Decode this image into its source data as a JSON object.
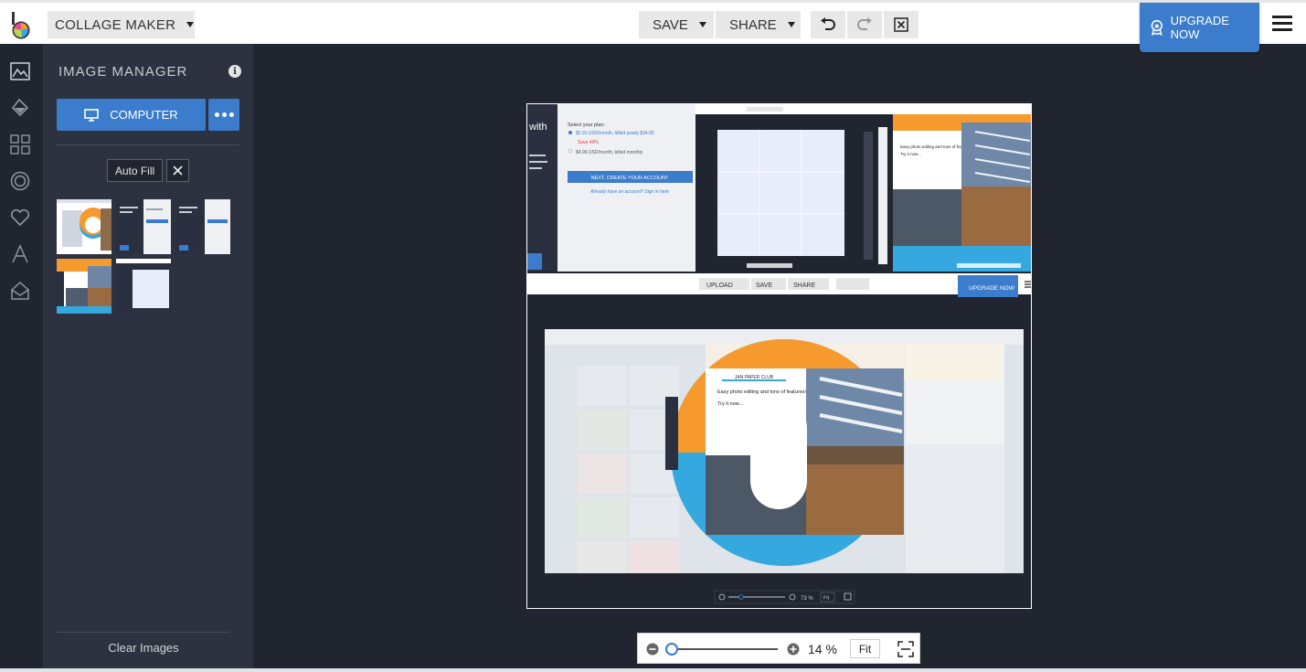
{
  "topbar": {
    "app_menu_label": "COLLAGE MAKER",
    "save_label": "SAVE",
    "share_label": "SHARE",
    "upgrade_label": "UPGRADE NOW",
    "icons": [
      "logo",
      "undo-icon",
      "redo-icon",
      "close-doc-icon",
      "upgrade-icon",
      "hamburger-icon"
    ]
  },
  "rail": {
    "icons": [
      "image-manager-icon",
      "background-icon",
      "layouts-icon",
      "effects-icon",
      "favorites-icon",
      "text-icon",
      "graphics-icon"
    ]
  },
  "image_manager": {
    "title": "IMAGE MANAGER",
    "computer_label": "COMPUTER",
    "autofill_label": "Auto Fill",
    "clear_label": "Clear Images",
    "thumbnail_count": 5
  },
  "canvas": {
    "top_left": {
      "heading_fragment": "with",
      "plan_title": "Select your plan:",
      "plan_1": "$2.91 USD/month, billed yearly $34.95",
      "save_badge": "Save 40%",
      "plan_2": "$4.96 USD/month, billed monthly",
      "cta": "NEXT, CREATE YOUR ACCOUNT",
      "signin": "Already have an account? Sign in here"
    },
    "top_right": {
      "headline": "Easy photo editing and tons of features!",
      "sub": "Try it now..."
    },
    "lower": {
      "upload_label": "UPLOAD",
      "save_label": "SAVE",
      "share_label": "SHARE",
      "upgrade_label": "UPGRADE NOW",
      "card_title": "JAN PAPER CLUB",
      "card_headline": "Easy photo editing and tons of features!",
      "card_sub": "Try it now...",
      "zoom_value": "73 %",
      "fit_label": "Fit"
    }
  },
  "zoom": {
    "value": "14 %",
    "fraction": 0.14,
    "fit_label": "Fit"
  },
  "colors": {
    "accent": "#3b7ccc",
    "app_bg": "#20252f",
    "panel_bg": "#2c323f",
    "orange": "#f79a2e",
    "sky": "#35a8e0"
  }
}
